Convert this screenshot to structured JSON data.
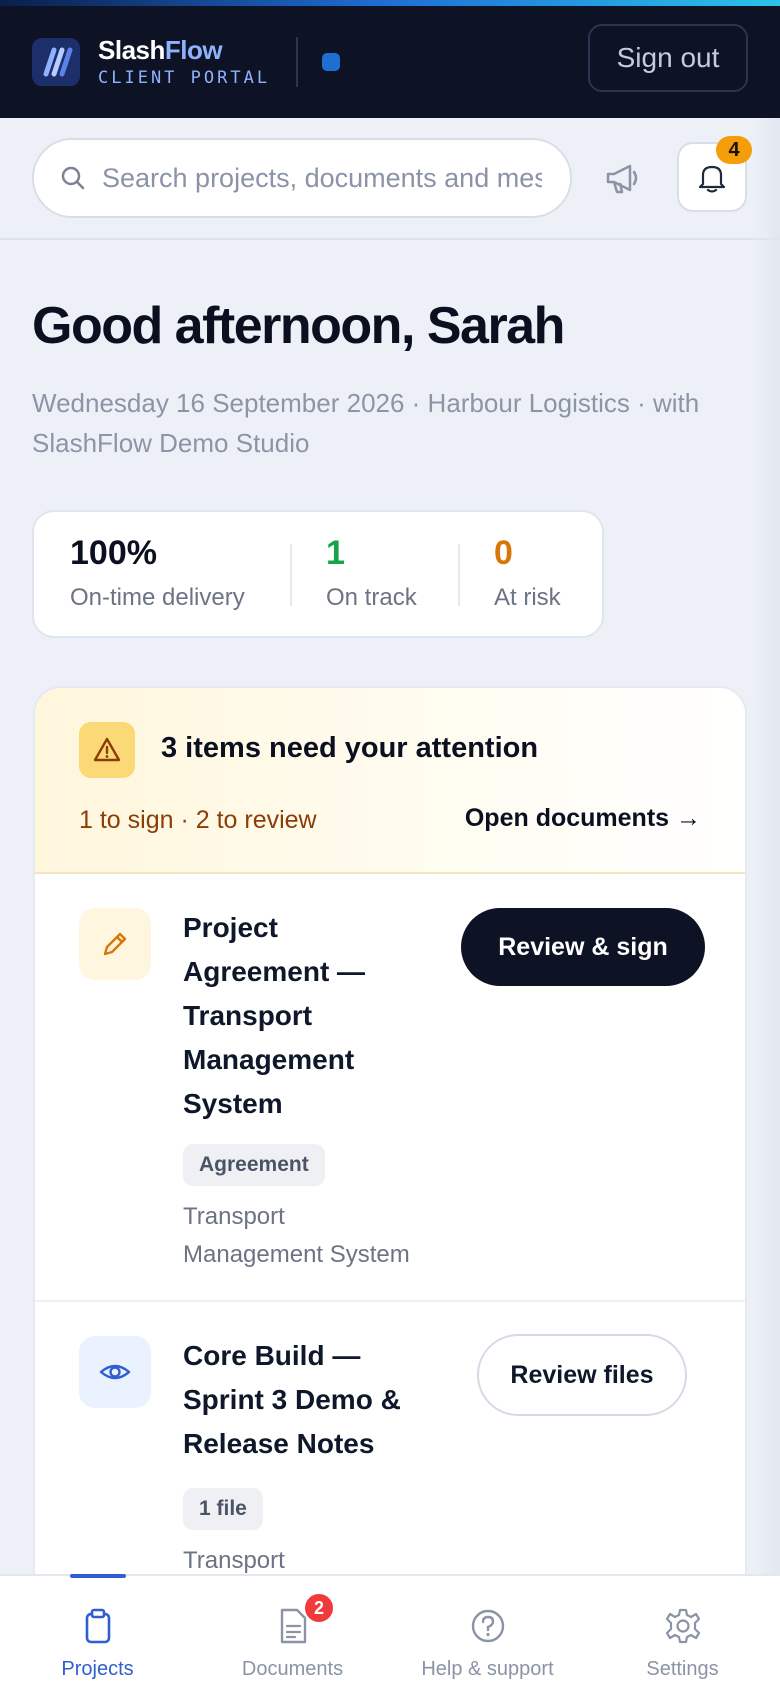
{
  "header": {
    "brand_part1": "Slash",
    "brand_part2": "Flow",
    "brand_sub": "CLIENT PORTAL",
    "signout_label": "Sign out"
  },
  "search": {
    "placeholder": "Search projects, documents and messages",
    "value": ""
  },
  "notifications": {
    "count": "4"
  },
  "greeting": {
    "title": "Good afternoon, Sarah",
    "subline": "Wednesday 16 September 2026 · Harbour Logistics · with SlashFlow Demo Studio"
  },
  "stats": [
    {
      "value": "100%",
      "label": "On-time delivery",
      "color": "#0b1020"
    },
    {
      "value": "1",
      "label": "On track",
      "color": "#16a34a"
    },
    {
      "value": "0",
      "label": "At risk",
      "color": "#d97706"
    }
  ],
  "attention": {
    "title": "3 items need your attention",
    "summary": "1 to sign · 2 to review",
    "open_link": "Open documents →",
    "items": [
      {
        "title_lines": [
          "Project",
          "Agreement —",
          "Transport",
          "Management",
          "System"
        ],
        "tag": "Agreement",
        "project_lines": [
          "Transport",
          "Management System"
        ],
        "action": "Review & sign",
        "icon": "pencil-icon"
      },
      {
        "title_lines": [
          "Core Build —",
          "Sprint 3 Demo &",
          "Release Notes"
        ],
        "tag": "1 file",
        "project_lines": [
          "Transport"
        ],
        "action": "Review files",
        "icon": "eye-icon"
      }
    ]
  },
  "nav": [
    {
      "label": "Projects",
      "icon": "clipboard-icon",
      "active": true
    },
    {
      "label": "Documents",
      "icon": "document-icon",
      "badge": "2"
    },
    {
      "label": "Help & support",
      "icon": "help-icon"
    },
    {
      "label": "Settings",
      "icon": "gear-icon"
    }
  ],
  "colors": {
    "accent": "#2f5fd0",
    "dark": "#0d1224",
    "warning": "#f59e0b",
    "danger": "#ef3b3b"
  }
}
